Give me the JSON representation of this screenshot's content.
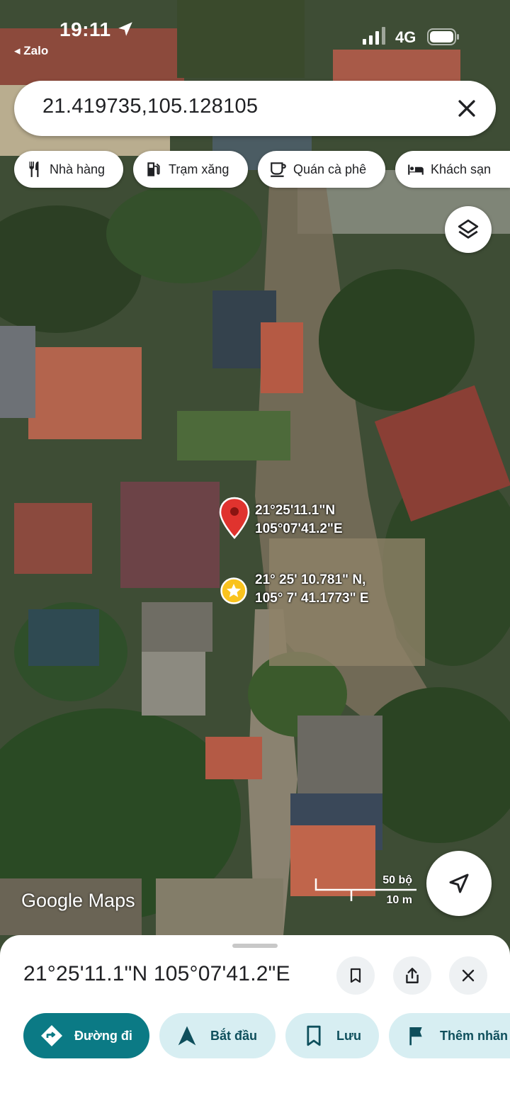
{
  "status_bar": {
    "time": "19:11",
    "back_app": "◂ Zalo",
    "network": "4G"
  },
  "search": {
    "value": "21.419735,105.128105"
  },
  "chips": [
    {
      "label": "Nhà hàng",
      "icon": "restaurant-icon"
    },
    {
      "label": "Trạm xăng",
      "icon": "gas-station-icon"
    },
    {
      "label": "Quán cà phê",
      "icon": "coffee-icon"
    },
    {
      "label": "Khách sạn",
      "icon": "hotel-icon"
    }
  ],
  "map": {
    "pin_label_line1": "21°25'11.1\"N",
    "pin_label_line2": "105°07'41.2\"E",
    "star_label_line1": "21° 25' 10.781\" N,",
    "star_label_line2": "105° 7' 41.1773\" E",
    "logo": "Google Maps",
    "scale_imperial": "50 bộ",
    "scale_metric": "10 m"
  },
  "sheet": {
    "title": "21°25'11.1\"N 105°07'41.2\"E",
    "actions": [
      {
        "label": "Đường đi",
        "icon": "directions-icon"
      },
      {
        "label": "Bắt đầu",
        "icon": "navigation-arrow-icon"
      },
      {
        "label": "Lưu",
        "icon": "bookmark-icon"
      },
      {
        "label": "Thêm nhãn",
        "icon": "flag-icon"
      }
    ]
  },
  "colors": {
    "accent": "#0b7a85",
    "pin": "#e0332e",
    "star": "#f9c31e",
    "chip_light": "#d7eef2"
  }
}
